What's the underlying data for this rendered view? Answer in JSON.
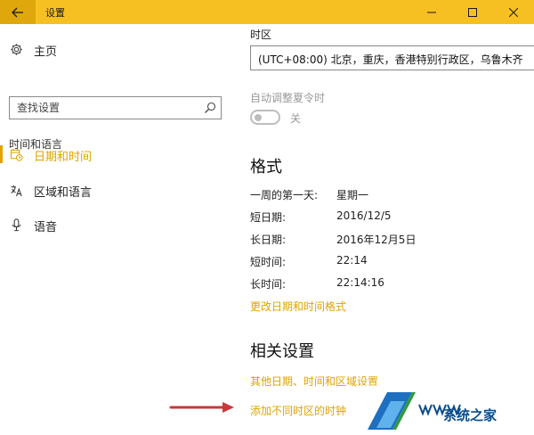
{
  "window": {
    "title": "设置",
    "controls": {
      "minimize": "minimize-icon",
      "maximize": "maximize-icon",
      "close": "close-icon"
    }
  },
  "sidebar": {
    "home": "主页",
    "search_placeholder": "查找设置",
    "section": "时间和语言",
    "items": [
      {
        "label": "日期和时间",
        "icon": "calendar-clock-icon",
        "active": true
      },
      {
        "label": "区域和语言",
        "icon": "language-icon",
        "active": false
      },
      {
        "label": "语音",
        "icon": "microphone-icon",
        "active": false
      }
    ]
  },
  "main": {
    "timezone_label": "时区",
    "timezone_value": "(UTC+08:00) 北京，重庆，香港特别行政区，乌鲁木齐",
    "dst_label": "自动调整夏令时",
    "dst_state": "关",
    "format_heading": "格式",
    "format_rows": [
      {
        "key": "一周的第一天:",
        "value": "星期一"
      },
      {
        "key": "短日期:",
        "value": "2016/12/5"
      },
      {
        "key": "长日期:",
        "value": "2016年12月5日"
      },
      {
        "key": "短时间:",
        "value": "22:14"
      },
      {
        "key": "长时间:",
        "value": "22:14:16"
      }
    ],
    "change_format_link": "更改日期和时间格式",
    "related_heading": "相关设置",
    "related_links": [
      "其他日期、时间和区域设置",
      "添加不同时区的时钟"
    ]
  },
  "watermark": {
    "text": "系统之家",
    "logo_text": "www"
  },
  "colors": {
    "accent": "#e0a300",
    "titlebar": "#f6c022",
    "back_button": "#e0a70d",
    "arrow": "#c8393b"
  }
}
